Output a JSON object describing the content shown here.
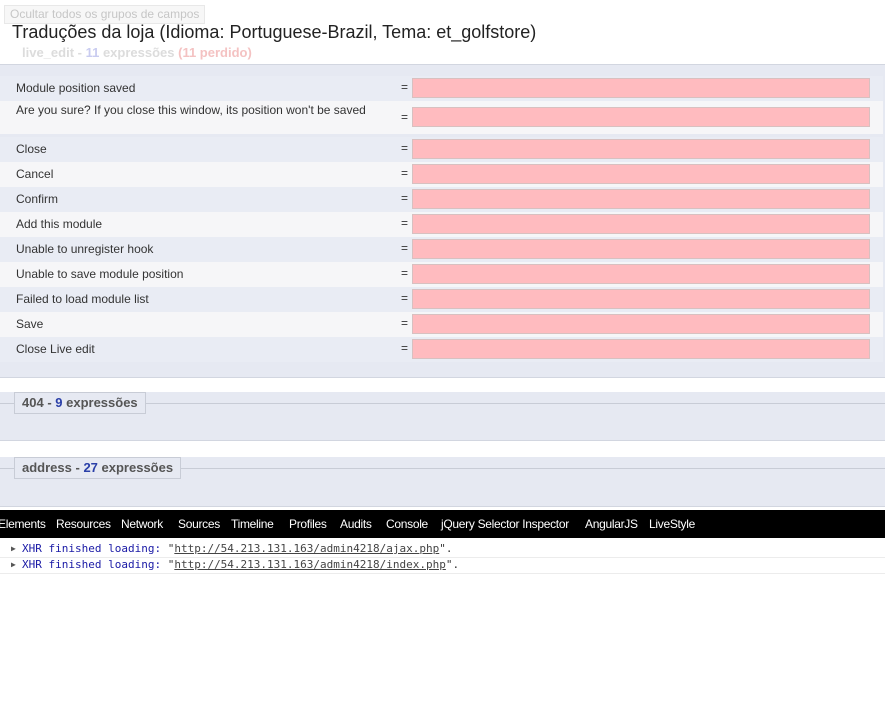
{
  "header": {
    "ghost_button": "Ocultar todos os grupos de campos",
    "title": "Traduções da loja (Idioma: Portuguese-Brazil, Tema: et_golfstore)",
    "ghost_legend": {
      "name": "live_edit",
      "sep": " - ",
      "count": "11",
      "word": " expressões ",
      "lost": "(11 perdido)"
    }
  },
  "translations": {
    "equals": "=",
    "rows": [
      {
        "label": "Module position saved",
        "value": ""
      },
      {
        "label": "Are you sure? If you close this window, its position won't be saved",
        "value": ""
      },
      {
        "label": "Close",
        "value": ""
      },
      {
        "label": "Cancel",
        "value": ""
      },
      {
        "label": "Confirm",
        "value": ""
      },
      {
        "label": "Add this module",
        "value": ""
      },
      {
        "label": "Unable to unregister hook",
        "value": ""
      },
      {
        "label": "Unable to save module position",
        "value": ""
      },
      {
        "label": "Failed to load module list",
        "value": ""
      },
      {
        "label": "Save",
        "value": ""
      },
      {
        "label": "Close Live edit",
        "value": ""
      }
    ]
  },
  "groups": [
    {
      "name": "404",
      "sep": " - ",
      "count": "9",
      "word": " expressões"
    },
    {
      "name": "address",
      "sep": " - ",
      "count": "27",
      "word": " expressões"
    }
  ],
  "devtools": {
    "tabs": [
      "Elements",
      "Resources",
      "Network",
      "Sources",
      "Timeline",
      "Profiles",
      "Audits",
      "Console",
      "jQuery Selector Inspector",
      "AngularJS",
      "LiveStyle"
    ],
    "console": [
      {
        "prefix": "XHR finished loading: ",
        "url": "http://54.213.131.163/admin4218/ajax.php",
        "suffix": "."
      },
      {
        "prefix": "XHR finished loading: ",
        "url": "http://54.213.131.163/admin4218/index.php",
        "suffix": "."
      }
    ]
  },
  "colors": {
    "missing_translation_bg": "#ffbbbf",
    "fieldset_bg": "#e6e9f2",
    "count_blue": "#2a3fa8",
    "devtools_bar": "#000000",
    "console_blue": "#1a1aa6"
  }
}
